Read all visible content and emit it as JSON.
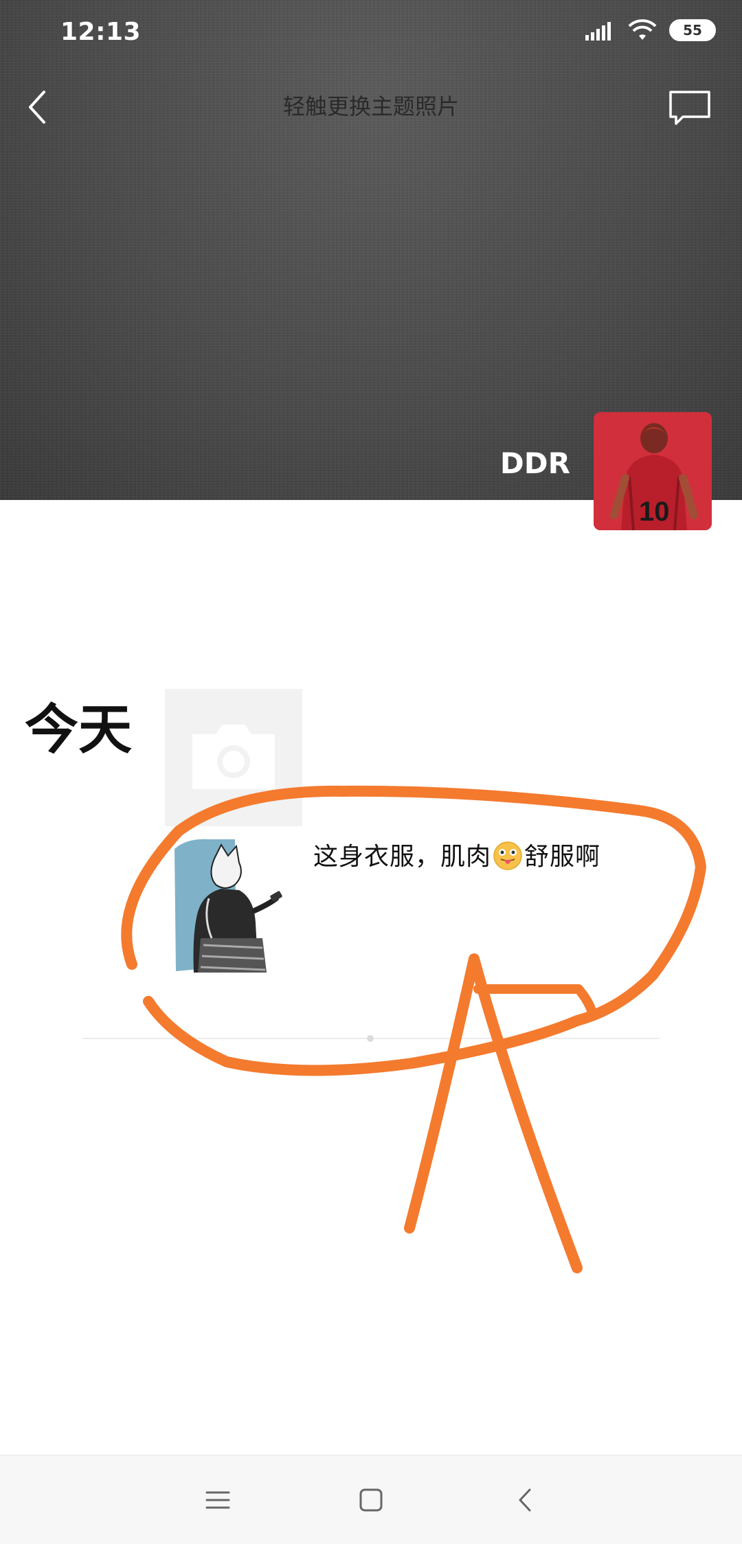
{
  "status_bar": {
    "time": "12:13",
    "battery": "55"
  },
  "header": {
    "title": "轻触更换主题照片",
    "owner_name": "DDR"
  },
  "feed": {
    "date_label": "今天",
    "post": {
      "text_before": "这身衣服，肌肉",
      "emoji": "face-with-tongue-emoji",
      "text_after": "舒服啊"
    }
  },
  "colors": {
    "cover_bg": "#4a4a4a",
    "avatar_red": "#d0303c",
    "scribble_orange": "#f47a2e"
  }
}
